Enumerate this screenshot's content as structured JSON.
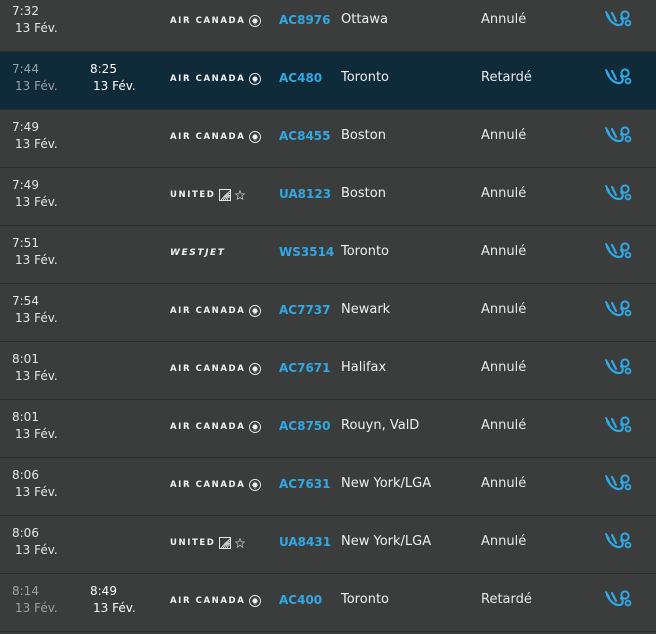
{
  "accent_color": "#2fa8e6",
  "highlight_color": "#0f2a38",
  "rows": [
    {
      "time": "7:32",
      "date": "13 Fév.",
      "revised_time": "",
      "revised_date": "",
      "airline": "AIR CANADA",
      "flight": "AC8976",
      "destination": "Ottawa",
      "status": "Annulé",
      "icon": "plane-track-icon"
    },
    {
      "time": "7:44",
      "date": "13 Fév.",
      "revised_time": "8:25",
      "revised_date": "13 Fév.",
      "airline": "AIR CANADA",
      "flight": "AC480",
      "destination": "Toronto",
      "status": "Retardé",
      "icon": "plane-track-icon"
    },
    {
      "time": "7:49",
      "date": "13 Fév.",
      "revised_time": "",
      "revised_date": "",
      "airline": "AIR CANADA",
      "flight": "AC8455",
      "destination": "Boston",
      "status": "Annulé",
      "icon": "plane-track-icon"
    },
    {
      "time": "7:49",
      "date": "13 Fév.",
      "revised_time": "",
      "revised_date": "",
      "airline": "UNITED",
      "flight": "UA8123",
      "destination": "Boston",
      "status": "Annulé",
      "icon": "plane-track-icon"
    },
    {
      "time": "7:51",
      "date": "13 Fév.",
      "revised_time": "",
      "revised_date": "",
      "airline": "WESTJET",
      "flight": "WS3514",
      "destination": "Toronto",
      "status": "Annulé",
      "icon": "plane-track-icon"
    },
    {
      "time": "7:54",
      "date": "13 Fév.",
      "revised_time": "",
      "revised_date": "",
      "airline": "AIR CANADA",
      "flight": "AC7737",
      "destination": "Newark",
      "status": "Annulé",
      "icon": "plane-track-icon"
    },
    {
      "time": "8:01",
      "date": "13 Fév.",
      "revised_time": "",
      "revised_date": "",
      "airline": "AIR CANADA",
      "flight": "AC7671",
      "destination": "Halifax",
      "status": "Annulé",
      "icon": "plane-track-icon"
    },
    {
      "time": "8:01",
      "date": "13 Fév.",
      "revised_time": "",
      "revised_date": "",
      "airline": "AIR CANADA",
      "flight": "AC8750",
      "destination": "Rouyn, ValD",
      "status": "Annulé",
      "icon": "plane-track-icon"
    },
    {
      "time": "8:06",
      "date": "13 Fév.",
      "revised_time": "",
      "revised_date": "",
      "airline": "AIR CANADA",
      "flight": "AC7631",
      "destination": "New York/LGA",
      "status": "Annulé",
      "icon": "plane-track-icon"
    },
    {
      "time": "8:06",
      "date": "13 Fév.",
      "revised_time": "",
      "revised_date": "",
      "airline": "UNITED",
      "flight": "UA8431",
      "destination": "New York/LGA",
      "status": "Annulé",
      "icon": "plane-track-icon"
    },
    {
      "time": "8:14",
      "date": "13 Fév.",
      "revised_time": "8:49",
      "revised_date": "13 Fév.",
      "airline": "AIR CANADA",
      "flight": "AC400",
      "destination": "Toronto",
      "status": "Retardé",
      "icon": "plane-track-icon"
    }
  ]
}
